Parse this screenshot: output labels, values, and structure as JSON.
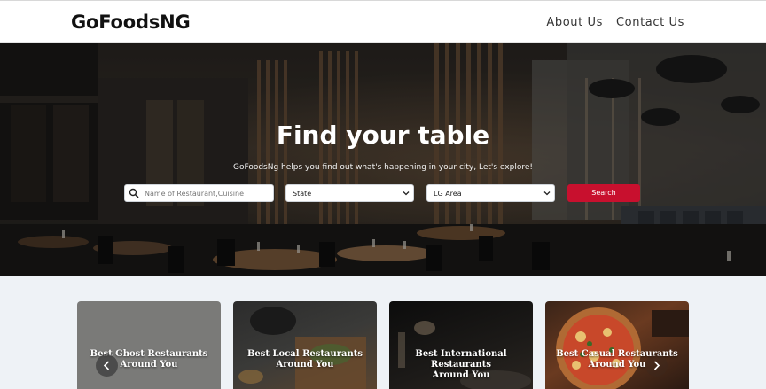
{
  "nav": {
    "brand": "GoFoodsNG",
    "links": [
      "About Us",
      "Contact Us"
    ]
  },
  "hero": {
    "title": "Find your table",
    "subtitle": "GoFoodsNg helps you find out what's happening in your city, Let's explore!",
    "search_placeholder": "Name of Restaurant,Cuisine",
    "state_select": "State",
    "lga_select": "LG Area",
    "search_button": "Search"
  },
  "cards": [
    {
      "label_line1": "Best Ghost Restaurants",
      "label_line2": "Around You"
    },
    {
      "label_line1": "Best Local Restaurants",
      "label_line2": "Around You"
    },
    {
      "label_line1": "Best International Restaurants",
      "label_line2": "Around You"
    },
    {
      "label_line1": "Best Casual Restaurants",
      "label_line2": "Around You"
    }
  ],
  "icons": {
    "search": "search-icon",
    "chevron_down": "chevron-down-icon",
    "prev": "chevron-left-icon",
    "next": "chevron-right-icon"
  },
  "colors": {
    "accent": "#c8102e",
    "page_bg": "#eef2f6"
  }
}
